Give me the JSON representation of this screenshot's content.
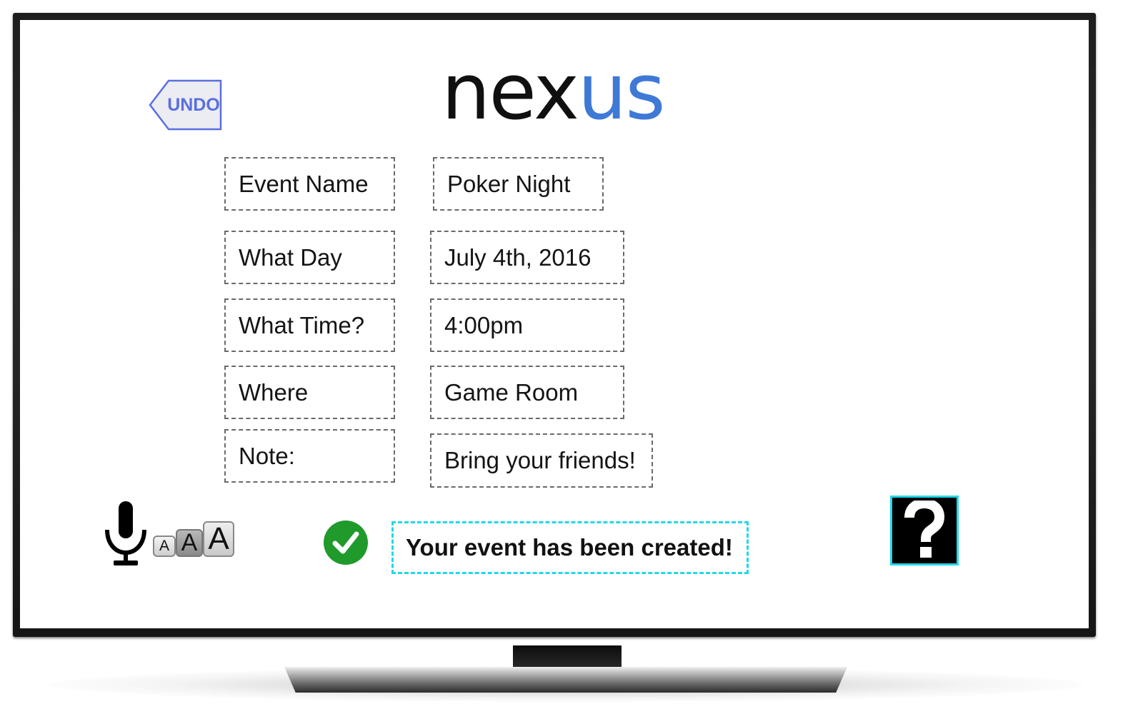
{
  "app": {
    "logo_dark": "nex",
    "logo_blue": "us"
  },
  "toolbar": {
    "undo_label": "UNDO"
  },
  "form": {
    "fields": [
      {
        "label": "Event Name",
        "value": "Poker Night"
      },
      {
        "label": "What Day",
        "value": "July 4th, 2016"
      },
      {
        "label": "What Time?",
        "value": "4:00pm"
      },
      {
        "label": "Where",
        "value": "Game Room"
      },
      {
        "label": "Note:",
        "value": "Bring your friends!"
      }
    ]
  },
  "accessibility": {
    "mic_icon": "microphone-icon",
    "text_sizes": [
      "A",
      "A",
      "A"
    ]
  },
  "status": {
    "icon": "check-circle-icon",
    "message": "Your event has been created!"
  },
  "help": {
    "label": "?"
  },
  "colors": {
    "brand_blue": "#3f79d6",
    "undo_blue": "#5a6fe0",
    "success_green": "#1f9a2b",
    "highlight_cyan": "#22d8e8"
  }
}
